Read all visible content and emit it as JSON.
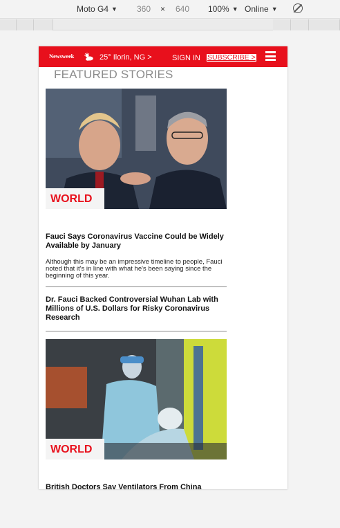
{
  "devtools": {
    "device": "Moto G4",
    "width": "360",
    "times": "×",
    "height": "640",
    "zoom": "100%",
    "throttle": "Online"
  },
  "header": {
    "logo": "Newsweek",
    "weather": "25° Ilorin, NG >",
    "signin": "SIGN IN",
    "subscribe": "SUBSCRIBE >"
  },
  "section_title": "FEATURED STORIES",
  "stories": [
    {
      "tag": "WORLD",
      "headline": "Fauci Says Coronavirus Vaccine Could be Widely Available by January",
      "dek": "Although this may be an impressive timeline to people, Fauci noted that it's in line with what he's been saying since the beginning of this year."
    },
    {
      "headline": "Dr. Fauci Backed Controversial Wuhan Lab with Millions of U.S. Dollars for Risky Coronavirus Research"
    },
    {
      "tag": "WORLD",
      "headline": "British Doctors Say Ventilators From China"
    }
  ],
  "colors": {
    "brand_red": "#e8101c",
    "section_gray": "#8c8c8c"
  }
}
